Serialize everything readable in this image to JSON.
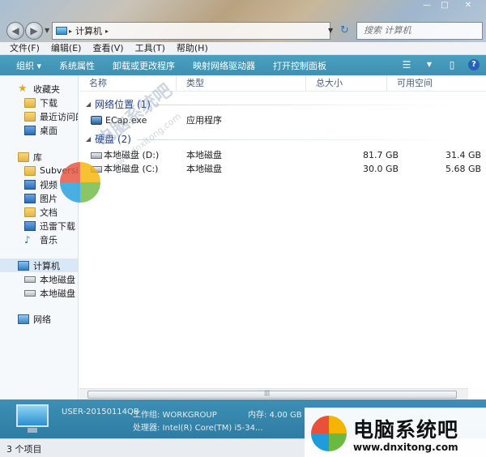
{
  "window": {
    "controls": {
      "minimize": "—",
      "maximize": "□",
      "close": "✕"
    }
  },
  "address": {
    "crumbs": [
      "计算机"
    ],
    "search_placeholder": "搜索 计算机"
  },
  "menu": [
    "文件(F)",
    "编辑(E)",
    "查看(V)",
    "工具(T)",
    "帮助(H)"
  ],
  "toolbar": {
    "buttons": [
      "组织 ▾",
      "系统属性",
      "卸载或更改程序",
      "映射网络驱动器",
      "打开控制面板"
    ]
  },
  "sidebar": {
    "favorites": {
      "label": "收藏夹",
      "items": [
        "下载",
        "最近访问的",
        "桌面"
      ]
    },
    "libraries": {
      "label": "库",
      "items": [
        "Subversion",
        "视频",
        "图片",
        "文档",
        "迅雷下载",
        "音乐"
      ]
    },
    "computer": {
      "label": "计算机",
      "items": [
        "本地磁盘 (C",
        "本地磁盘 (D"
      ]
    },
    "network": {
      "label": "网络"
    }
  },
  "columns": {
    "name": "名称",
    "type": "类型",
    "total": "总大小",
    "free": "可用空间"
  },
  "groups": {
    "network": {
      "title": "网络位置 (1)",
      "items": [
        {
          "name": "ECap.exe",
          "type": "应用程序"
        }
      ]
    },
    "disks": {
      "title": "硬盘 (2)",
      "items": [
        {
          "name": "本地磁盘 (D:)",
          "type": "本地磁盘",
          "total": "81.7 GB",
          "free": "31.4 GB"
        },
        {
          "name": "本地磁盘 (C:)",
          "type": "本地磁盘",
          "total": "30.0 GB",
          "free": "5.68 GB"
        }
      ]
    }
  },
  "details": {
    "computer_name": "USER-20150114QB",
    "workgroup": "工作组: WORKGROUP",
    "memory": "内存: 4.00 GB",
    "processor": "处理器: Intel(R) Core(TM) i5-34..."
  },
  "status": {
    "items_count": "3 个项目"
  },
  "watermark": {
    "title": "电脑系统吧",
    "url": "www.dnxitong.com",
    "diag_title": "电脑系统吧",
    "diag_url": "www.dnxitong.com"
  }
}
